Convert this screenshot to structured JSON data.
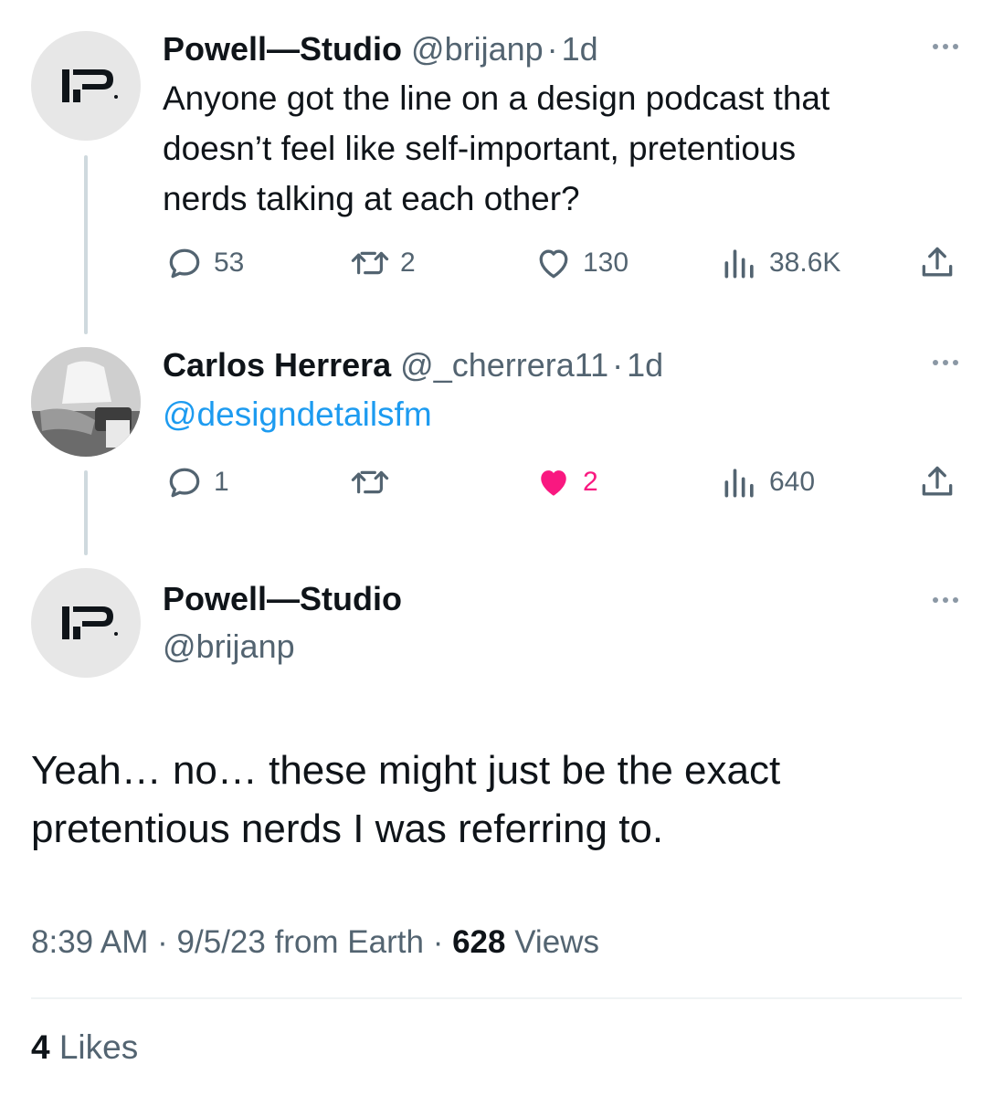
{
  "tweet1": {
    "name": "Powell—Studio",
    "handle": "@brijanp",
    "separator": "·",
    "time": "1d",
    "text_lines": [
      "Anyone got the line on a design podcast that",
      "doesn’t feel like self-important, pretentious",
      "nerds talking at each other?"
    ],
    "replies": "53",
    "retweets": "2",
    "likes": "130",
    "views": "38.6K"
  },
  "tweet2": {
    "name": "Carlos Herrera",
    "handle": "@_cherrera11",
    "separator": "·",
    "time": "1d",
    "mention": "@designdetailsfm",
    "replies": "1",
    "retweets": "",
    "likes": "2",
    "views": "640"
  },
  "main": {
    "name": "Powell—Studio",
    "handle": "@brijanp",
    "text_lines": [
      "Yeah… no… these might just be the exact",
      "pretentious nerds I was referring to."
    ],
    "time": "8:39 AM",
    "date": "9/5/23 from Earth",
    "separator": "·",
    "views_count": "628",
    "views_label": " Views",
    "likes_count": "4",
    "likes_label": " Likes"
  },
  "colors": {
    "like_active": "#f91880",
    "link": "#1d9bf0",
    "muted": "#536471"
  },
  "icons": [
    "reply-icon",
    "retweet-icon",
    "like-icon",
    "views-icon",
    "share-icon",
    "more-icon",
    "logo-icon"
  ]
}
